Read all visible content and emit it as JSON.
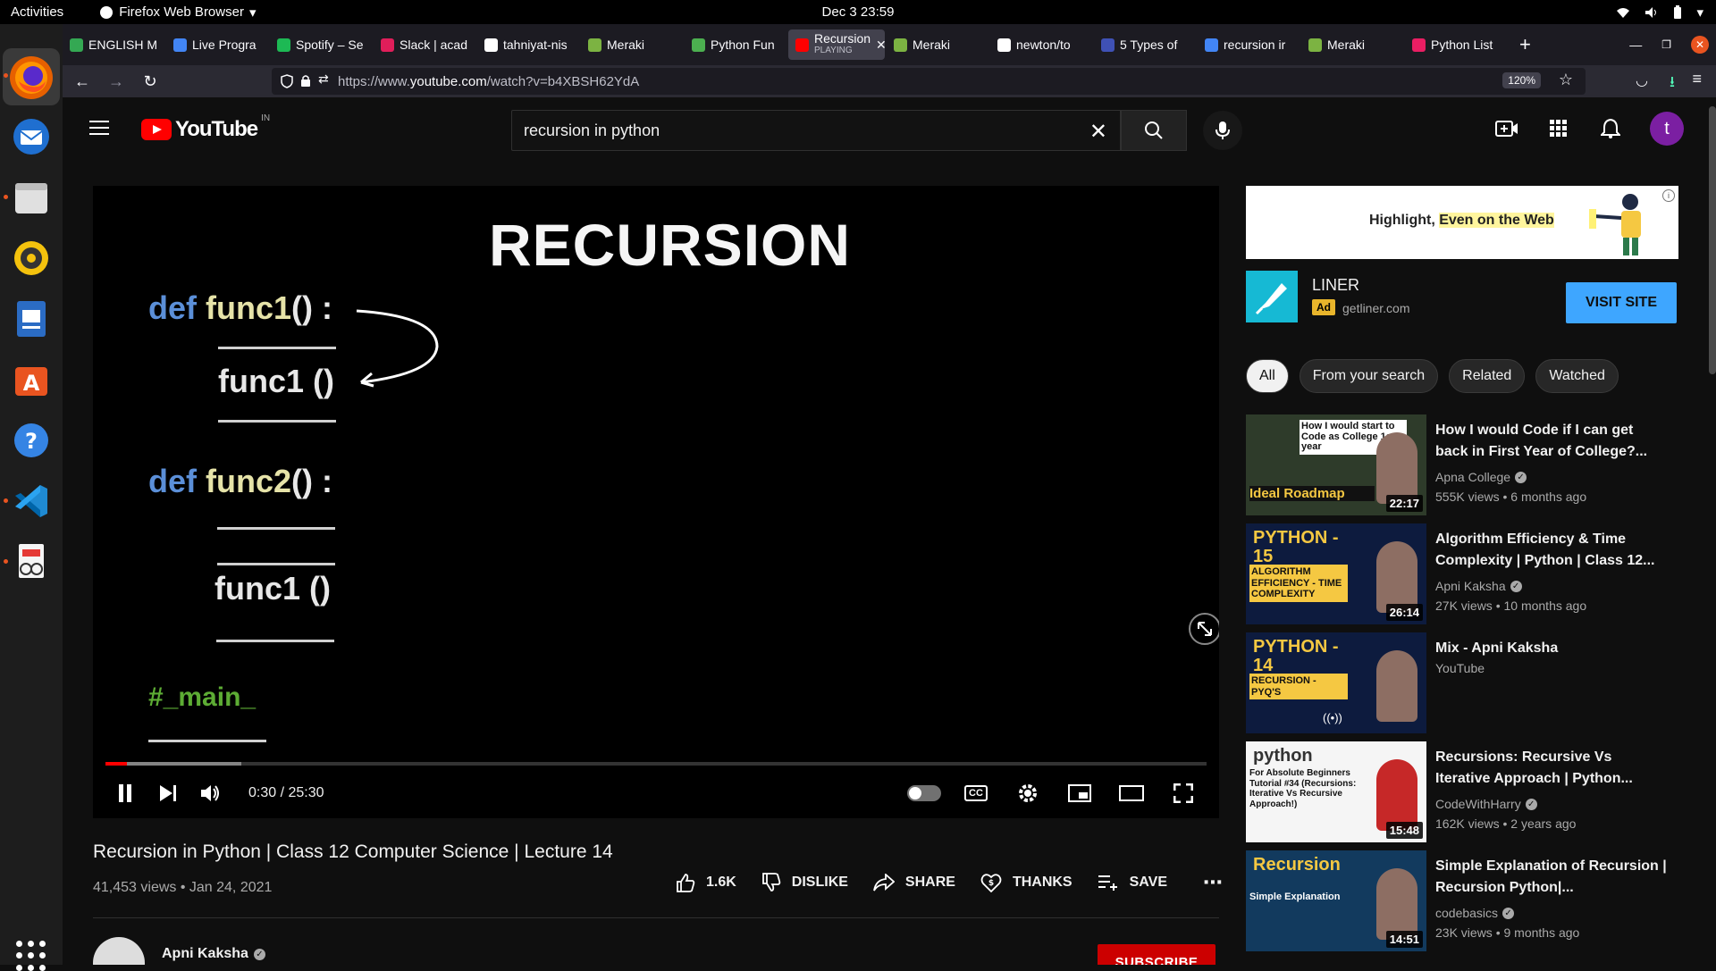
{
  "system": {
    "activities": "Activities",
    "app_name": "Firefox Web Browser",
    "clock": "Dec 3  23:59"
  },
  "tabs": [
    {
      "label": "ENGLISH M",
      "color": "#34a853"
    },
    {
      "label": "Live Progra",
      "color": "#4285f4"
    },
    {
      "label": "Spotify – Se",
      "color": "#1db954"
    },
    {
      "label": "Slack | acad",
      "color": "#e01e5a"
    },
    {
      "label": "tahniyat-nis",
      "color": "#ffffff"
    },
    {
      "label": "Meraki",
      "color": "#7cb342"
    },
    {
      "label": "Python Fun",
      "color": "#4caf50"
    },
    {
      "label": "Recursion",
      "sublabel": "PLAYING",
      "color": "#ff0000",
      "active": true
    },
    {
      "label": "Meraki",
      "color": "#7cb342"
    },
    {
      "label": "newton/to",
      "color": "#ffffff"
    },
    {
      "label": "5 Types of",
      "color": "#3f51b5"
    },
    {
      "label": "recursion ir",
      "color": "#4285f4"
    },
    {
      "label": "Meraki",
      "color": "#7cb342"
    },
    {
      "label": "Python List",
      "color": "#e91e63"
    }
  ],
  "address_bar": {
    "url_prefix": "https://www.",
    "url_host": "youtube.com",
    "url_path": "/watch?v=b4XBSH62YdA",
    "zoom": "120%"
  },
  "youtube": {
    "logo": "YouTube",
    "region": "IN",
    "search_value": "recursion in python",
    "avatar_letter": "t"
  },
  "video": {
    "frame_title": "RECURSION",
    "code": {
      "def1_kw": "def",
      "def1_fn": "func1",
      "def1_rest": "() :",
      "call1": "func1 ()",
      "def2_kw": "def",
      "def2_fn": "func2",
      "def2_rest": "() :",
      "call2": "func1 ()",
      "main": "#_main_"
    },
    "time": "0:30 / 25:30",
    "played_fraction": 0.0196,
    "buffered_fraction": 0.123,
    "title": "Recursion in Python | Class 12 Computer Science | Lecture 14",
    "meta": "41,453 views • Jan 24, 2021",
    "likes": "1.6K",
    "dislike": "DISLIKE",
    "share": "SHARE",
    "thanks": "THANKS",
    "save": "SAVE",
    "channel": "Apni Kaksha",
    "subscribe": "SUBSCRIBE"
  },
  "ad": {
    "banner_text_1": "Highlight, ",
    "banner_text_2": "Even on the Web",
    "name": "LINER",
    "badge": "Ad",
    "site": "getliner.com",
    "cta": "VISIT SITE"
  },
  "chips": [
    "All",
    "From your search",
    "Related",
    "Watched"
  ],
  "recommendations": [
    {
      "title": "How I would Code if I can get back in First Year of College?...",
      "channel": "Apna College",
      "verified": true,
      "meta": "555K views • 6 months ago",
      "duration": "22:17",
      "thumb_text": "How I would start to Code as College 1st year",
      "thumb_sub": "Ideal Roadmap",
      "thumb_bg": "#2e3b2a"
    },
    {
      "title": "Algorithm Efficiency & Time Complexity | Python | Class 12...",
      "channel": "Apni Kaksha",
      "verified": true,
      "meta": "27K views • 10 months ago",
      "duration": "26:14",
      "thumb_text": "PYTHON - 15",
      "thumb_sub": "ALGORITHM EFFICIENCY - TIME COMPLEXITY",
      "thumb_bg": "#0d1b3e"
    },
    {
      "title": "Mix - Apni Kaksha",
      "channel": "YouTube",
      "verified": false,
      "meta": "",
      "duration": "",
      "thumb_text": "PYTHON - 14",
      "thumb_sub": "RECURSION - PYQ'S",
      "thumb_bg": "#0d1b3e"
    },
    {
      "title": "Recursions: Recursive Vs Iterative Approach | Python...",
      "channel": "CodeWithHarry",
      "verified": true,
      "meta": "162K views • 2 years ago",
      "duration": "15:48",
      "thumb_text": "python",
      "thumb_sub": "For Absolute Beginners Tutorial #34 (Recursions: Iterative Vs Recursive Approach!)",
      "thumb_bg": "#f5f5f5"
    },
    {
      "title": "Simple Explanation of Recursion | Recursion Python|...",
      "channel": "codebasics",
      "verified": true,
      "meta": "23K views • 9 months ago",
      "duration": "14:51",
      "thumb_text": "Recursion",
      "thumb_sub": "Simple Explanation",
      "thumb_bg": "#123a5e"
    }
  ]
}
